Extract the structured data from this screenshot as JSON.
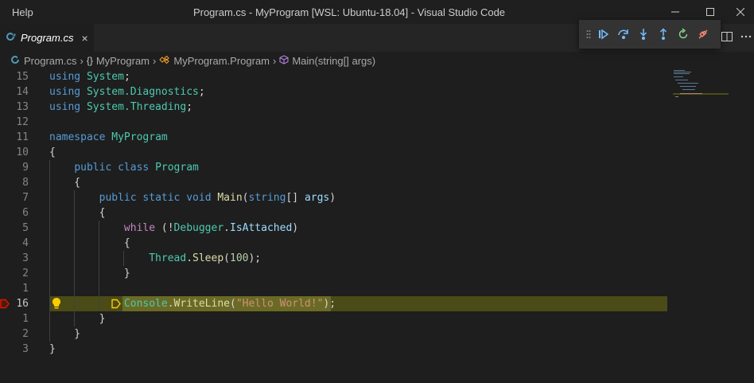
{
  "titlebar": {
    "menu_help": "Help",
    "title": "Program.cs - MyProgram [WSL: Ubuntu-18.04] - Visual Studio Code"
  },
  "tab": {
    "icon": "C#",
    "label": "Program.cs",
    "close": "×"
  },
  "breadcrumb": {
    "file": "Program.cs",
    "namespace": "MyProgram",
    "class": "MyProgram.Program",
    "method": "Main(string[] args)"
  },
  "gutter": [
    "15",
    "14",
    "13",
    "12",
    "11",
    "10",
    "9",
    "8",
    "7",
    "6",
    "5",
    "4",
    "3",
    "2",
    "1",
    "16",
    "1",
    "2",
    "3"
  ],
  "code_lines": [
    [
      [
        "kw",
        "using"
      ],
      [
        "pl",
        " "
      ],
      [
        "ns",
        "System"
      ],
      [
        "pl",
        ";"
      ]
    ],
    [
      [
        "kw",
        "using"
      ],
      [
        "pl",
        " "
      ],
      [
        "ns",
        "System.Diagnostics"
      ],
      [
        "pl",
        ";"
      ]
    ],
    [
      [
        "kw",
        "using"
      ],
      [
        "pl",
        " "
      ],
      [
        "ns",
        "System.Threading"
      ],
      [
        "pl",
        ";"
      ]
    ],
    [],
    [
      [
        "kw",
        "namespace"
      ],
      [
        "pl",
        " "
      ],
      [
        "ns",
        "MyProgram"
      ]
    ],
    [
      [
        "pl",
        "{"
      ]
    ],
    [
      [
        "pl",
        "    "
      ],
      [
        "kw",
        "public"
      ],
      [
        "pl",
        " "
      ],
      [
        "kw",
        "class"
      ],
      [
        "pl",
        " "
      ],
      [
        "ty",
        "Program"
      ]
    ],
    [
      [
        "pl",
        "    {"
      ]
    ],
    [
      [
        "pl",
        "        "
      ],
      [
        "kw",
        "public"
      ],
      [
        "pl",
        " "
      ],
      [
        "kw",
        "static"
      ],
      [
        "pl",
        " "
      ],
      [
        "kw",
        "void"
      ],
      [
        "pl",
        " "
      ],
      [
        "fn",
        "Main"
      ],
      [
        "pl",
        "("
      ],
      [
        "kw",
        "string"
      ],
      [
        "pl",
        "[] "
      ],
      [
        "var",
        "args"
      ],
      [
        "pl",
        ")"
      ]
    ],
    [
      [
        "pl",
        "        {"
      ]
    ],
    [
      [
        "pl",
        "            "
      ],
      [
        "kw2",
        "while"
      ],
      [
        "pl",
        " (!"
      ],
      [
        "ty",
        "Debugger"
      ],
      [
        "pl",
        "."
      ],
      [
        "var",
        "IsAttached"
      ],
      [
        "pl",
        ")"
      ]
    ],
    [
      [
        "pl",
        "            {"
      ]
    ],
    [
      [
        "pl",
        "                "
      ],
      [
        "ty",
        "Thread"
      ],
      [
        "pl",
        "."
      ],
      [
        "fn",
        "Sleep"
      ],
      [
        "pl",
        "("
      ],
      [
        "num",
        "100"
      ],
      [
        "pl",
        ");"
      ]
    ],
    [
      [
        "pl",
        "            }"
      ]
    ],
    [],
    [
      [
        "pl",
        "            "
      ],
      [
        "ty",
        "Console"
      ],
      [
        "pl",
        "."
      ],
      [
        "fn",
        "WriteLine"
      ],
      [
        "pl",
        "("
      ],
      [
        "str",
        "\"Hello World!\""
      ],
      [
        "pl",
        ");"
      ]
    ],
    [
      [
        "pl",
        "        }"
      ]
    ],
    [
      [
        "pl",
        "    }"
      ]
    ],
    [
      [
        "pl",
        "}"
      ]
    ]
  ],
  "icons": {
    "grip": "grip-icon",
    "continue": "continue-icon",
    "step_over": "step-over-icon",
    "step_into": "step-into-icon",
    "step_out": "step-out-icon",
    "restart": "restart-icon",
    "disconnect": "disconnect-icon"
  },
  "colors": {
    "breakpoint": "#e51400",
    "current_line": "#4b4b18",
    "exec_arrow": "#ffcc00",
    "debug_blue": "#75beff",
    "restart_green": "#89d185",
    "disconnect_red": "#f48771"
  }
}
